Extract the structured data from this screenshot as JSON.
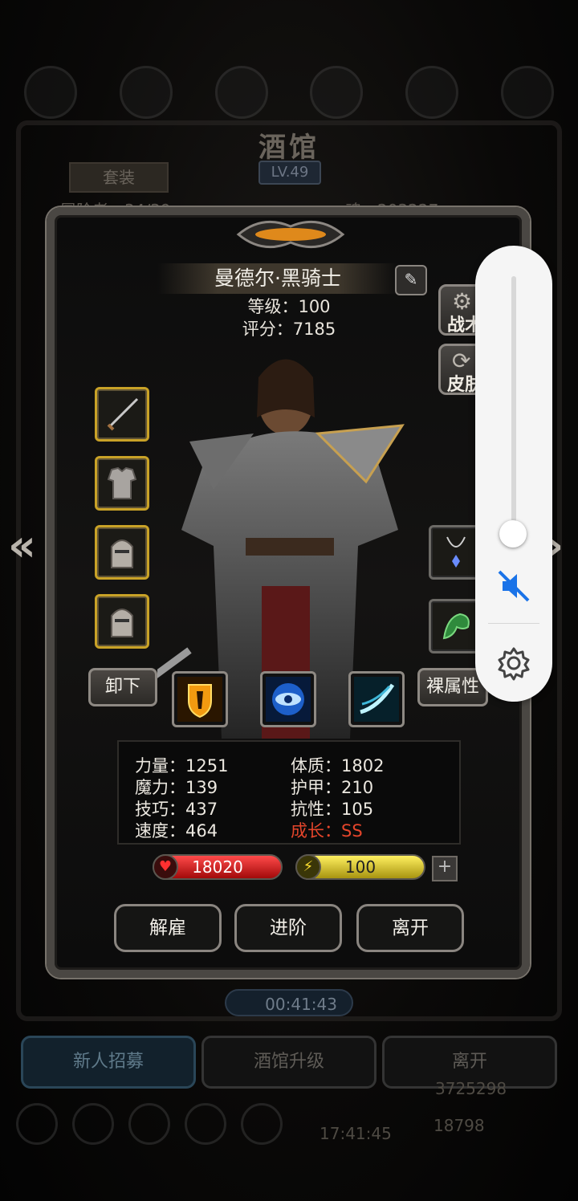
{
  "background": {
    "title": "酒馆",
    "level": "LV.49",
    "suit_tab": "套装",
    "count_label": "冒险者：34/39",
    "soul_label": "魂：203227",
    "timer": "00:41:43",
    "buttons": [
      "新人招募",
      "酒馆升级",
      "离开"
    ],
    "gold": "3725298",
    "gems": "18798",
    "clock": "17:41:45"
  },
  "hero": {
    "name": "曼德尔·黑骑士",
    "level_label": "等级：100",
    "score_label": "评分：7185"
  },
  "side_buttons": {
    "tactics": "战术",
    "skin": "皮肤"
  },
  "equipment": {
    "left": [
      "sword",
      "chest-armor",
      "helmet",
      "helmet"
    ],
    "right": [
      "necklace",
      "dragon-pet"
    ]
  },
  "actions_row": {
    "unequip": "卸下",
    "naked_stats": "裸属性"
  },
  "attributes": {
    "strength": "力量：1251",
    "constitution": "体质：1802",
    "magic": "魔力：139",
    "armor": "护甲：210",
    "skill": "技巧：437",
    "resistance": "抗性：105",
    "speed": "速度：464",
    "growth": "成长：SS",
    "growth_color": "#e4452b"
  },
  "bars": {
    "hp": "18020",
    "energy": "100"
  },
  "buttons": {
    "dismiss": "解雇",
    "advance": "进阶",
    "leave": "离开"
  },
  "volume": {
    "level": 0.04,
    "muted": true,
    "accent": "#1a73e8"
  }
}
